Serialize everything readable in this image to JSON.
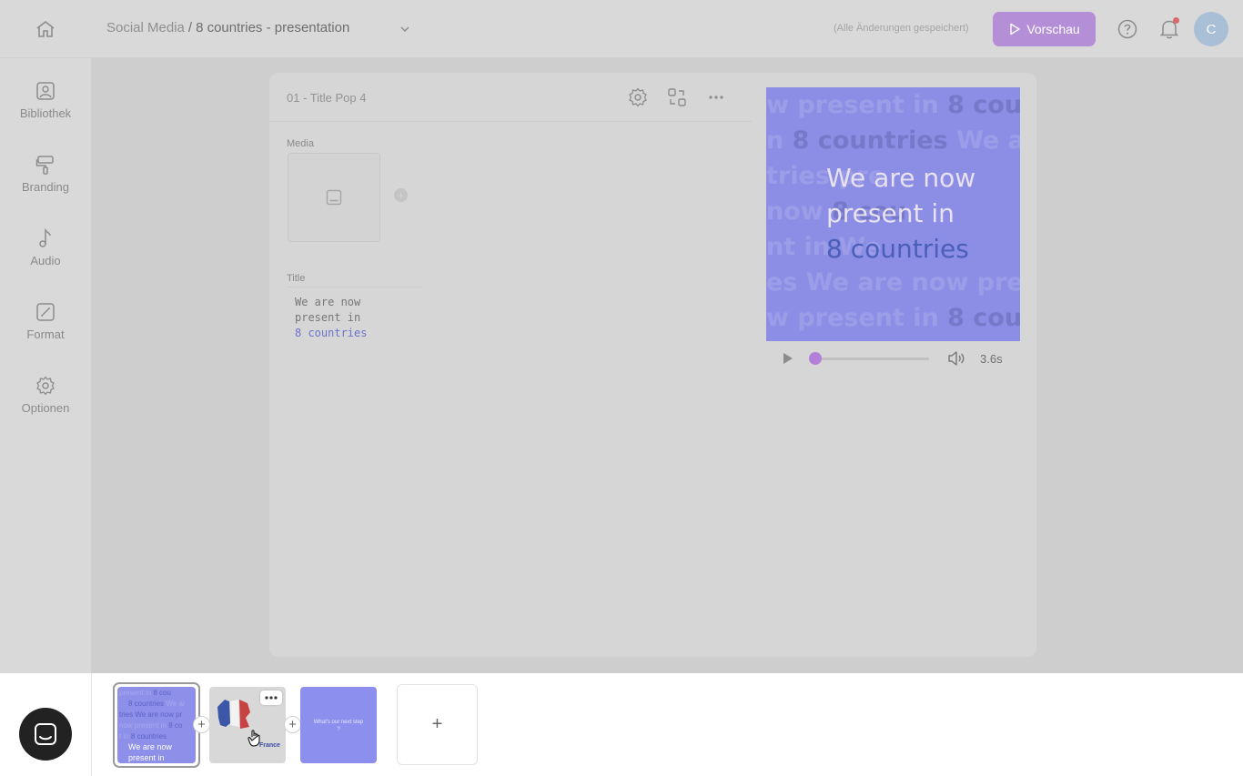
{
  "header": {
    "breadcrumb_folder": "Social Media",
    "breadcrumb_separator": "/",
    "breadcrumb_project": "8 countries - presentation",
    "saved_status": "(Alle Änderungen gespeichert)",
    "preview_label": "Vorschau",
    "avatar_initial": "C"
  },
  "sidebar": {
    "items": [
      {
        "label": "Bibliothek",
        "icon": "library-icon"
      },
      {
        "label": "Branding",
        "icon": "paint-roller-icon"
      },
      {
        "label": "Audio",
        "icon": "music-note-icon"
      },
      {
        "label": "Format",
        "icon": "resize-icon"
      },
      {
        "label": "Optionen",
        "icon": "gear-icon"
      }
    ]
  },
  "editor": {
    "scene_title": "01 - Title Pop 4",
    "media_label": "Media",
    "title_label": "Title",
    "title_line1": "We are now",
    "title_line2": "present in",
    "title_line3": "8 countries"
  },
  "preview": {
    "bg_lines": [
      {
        "a": "w present in ",
        "b": "8 coun"
      },
      {
        "a": "n ",
        "b": "8 countries",
        "c": " We ar"
      },
      {
        "a": "tries ",
        "b": "",
        "c": "                  pre"
      },
      {
        "a": "now ",
        "b": "",
        "c": "                  8 cou"
      },
      {
        "a": "nt in ",
        "b": "",
        "c": "                  We"
      },
      {
        "a": "es We are now prese",
        "b": "",
        "c": ""
      },
      {
        "a": "w present in ",
        "b": "8 coun"
      }
    ],
    "text_line1": "We are now",
    "text_line2": "present in",
    "text_line3": "8 countries",
    "duration": "3.6s",
    "progress": 0.0
  },
  "timeline": {
    "slide1_caption_line1": "We are now",
    "slide1_caption_line2": "present in",
    "slide1_mini": [
      {
        "a": "present in ",
        "b": "8 cou"
      },
      {
        "a": "8 countries",
        "b": " We ar"
      },
      {
        "a": "tries We are now pr",
        "b": ""
      },
      {
        "a": "now present in ",
        "b": "8 co"
      },
      {
        "a": "t in ",
        "b": "8 countries"
      }
    ],
    "slide2_label": "France",
    "slide3_label": "What's our next step ?",
    "add_label": "+",
    "insert_label": "+"
  },
  "colors": {
    "accent_purple": "#b48fd8",
    "slide_blue": "#8d8fe9",
    "text_blue": "#4c5fb8"
  }
}
